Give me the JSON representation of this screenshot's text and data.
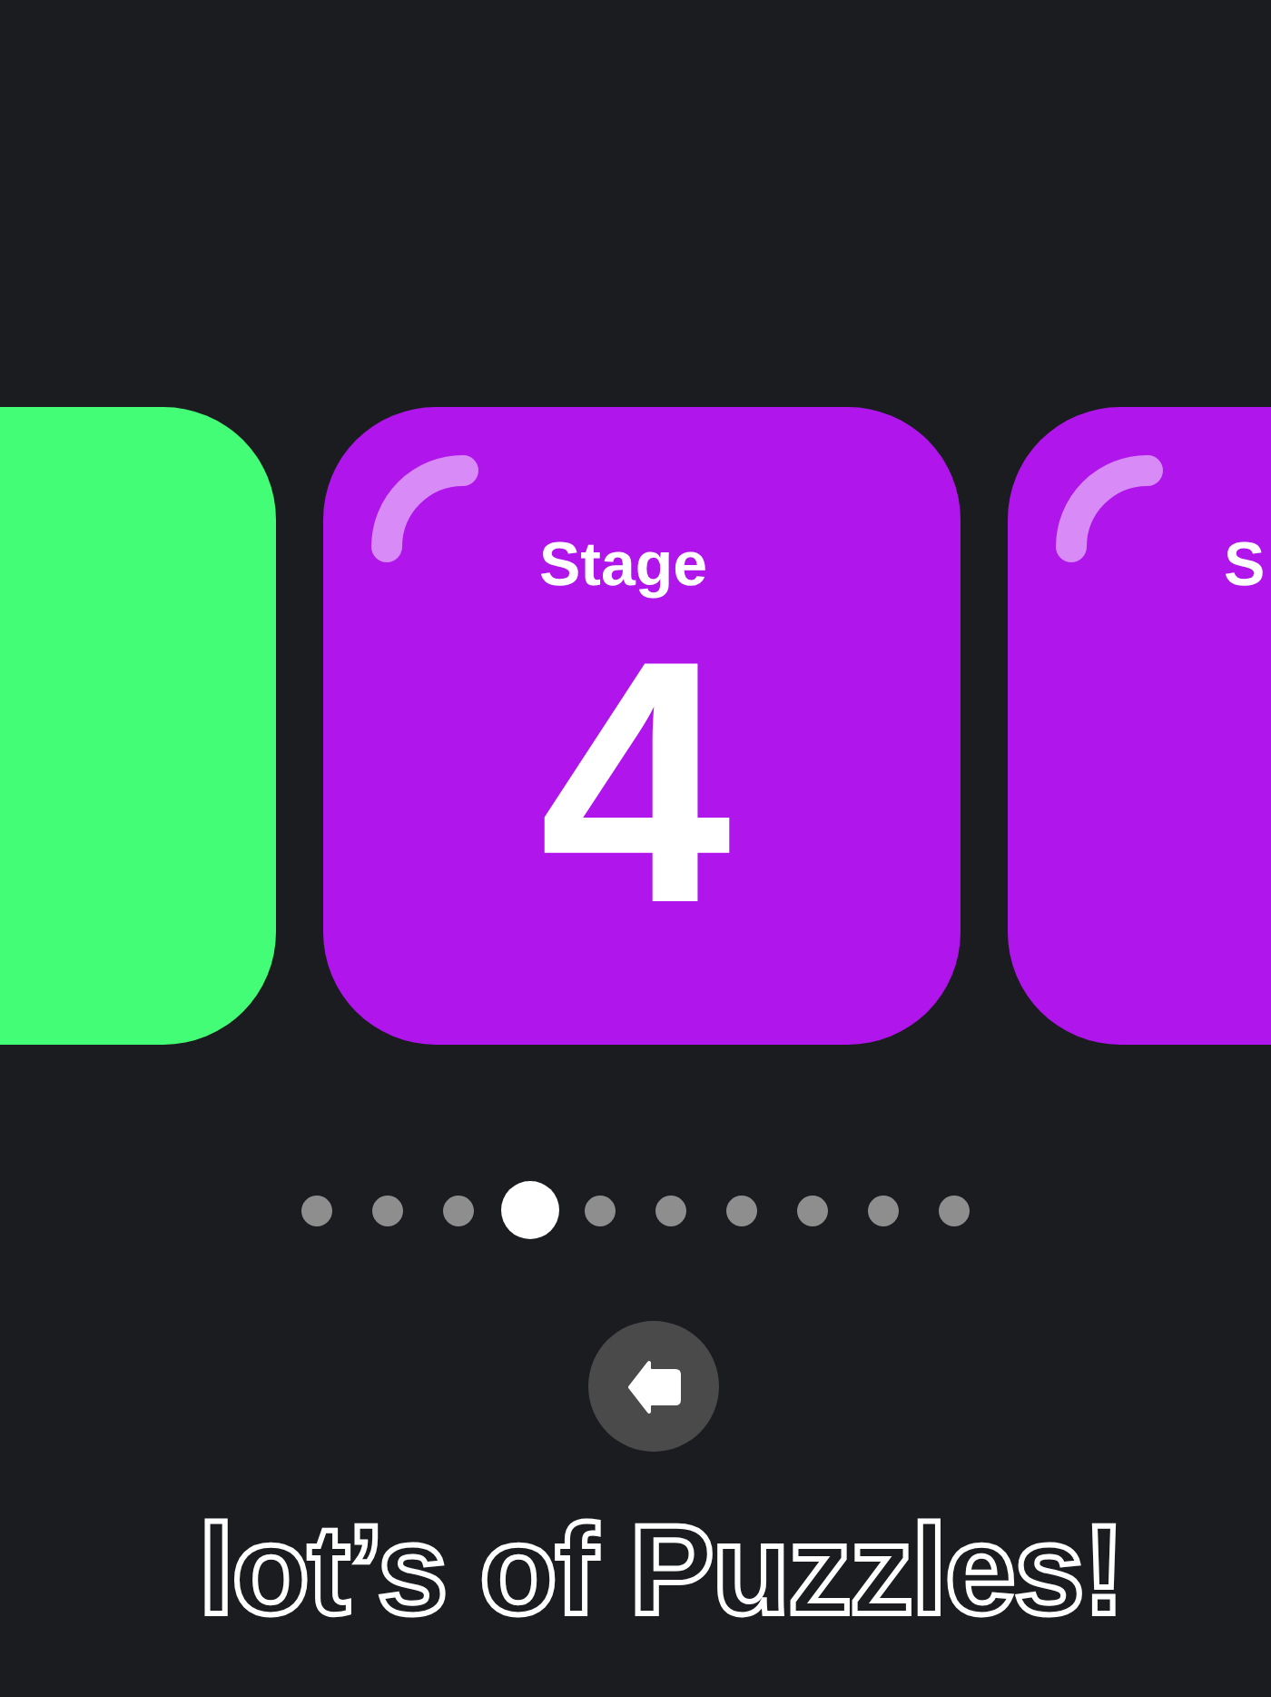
{
  "stage_cards": [
    {
      "color": "#43fd76"
    },
    {
      "color": "#b015ec",
      "label": "Stage",
      "number": "4"
    },
    {
      "color": "#b015ec",
      "label": "S"
    }
  ],
  "page_dots": [
    {
      "selected": false
    },
    {
      "selected": false
    },
    {
      "selected": false
    },
    {
      "selected": true
    },
    {
      "selected": false
    },
    {
      "selected": false
    },
    {
      "selected": false
    },
    {
      "selected": false
    },
    {
      "selected": false
    },
    {
      "selected": false
    }
  ],
  "headline": "lot’s of Puzzles!"
}
